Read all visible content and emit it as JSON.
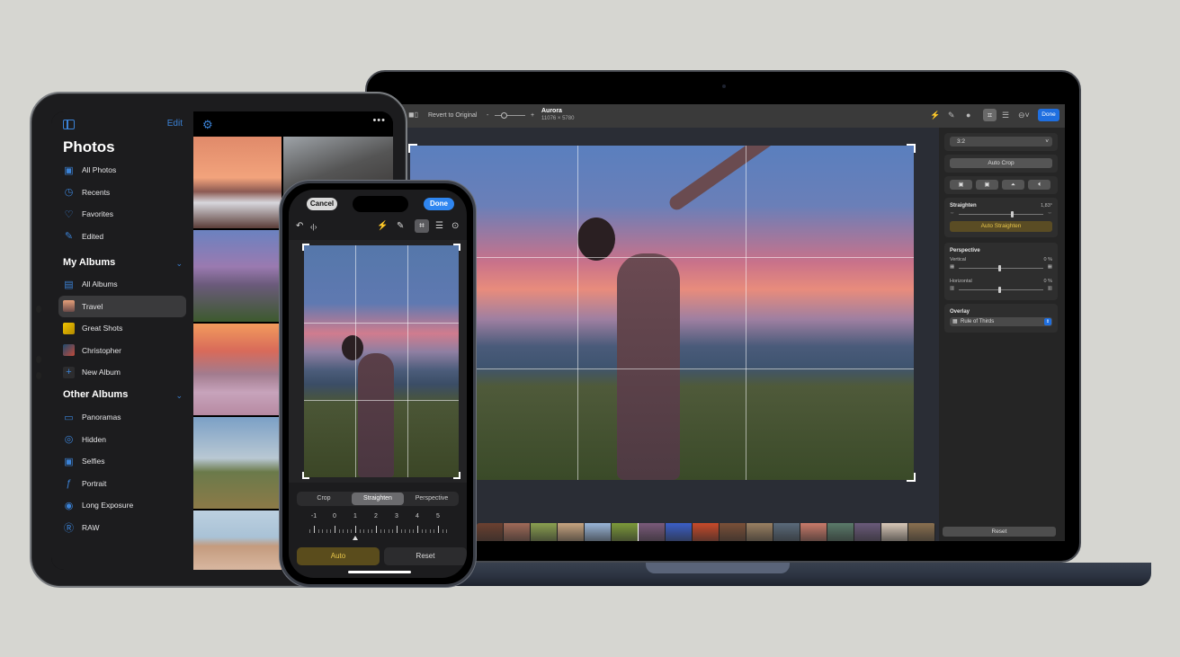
{
  "background_color": "#d6d6d1",
  "ipad": {
    "sidebar": {
      "edit_label": "Edit",
      "title": "Photos",
      "library_items": [
        {
          "label": "All Photos",
          "icon": "photo-library-icon"
        },
        {
          "label": "Recents",
          "icon": "clock-icon"
        },
        {
          "label": "Favorites",
          "icon": "heart-icon"
        },
        {
          "label": "Edited",
          "icon": "edit-square-icon"
        }
      ],
      "my_albums_heading": "My Albums",
      "my_albums": [
        {
          "label": "All Albums",
          "icon": "albums-stack-icon"
        },
        {
          "label": "Travel",
          "icon": "album-thumbnail",
          "selected": true
        },
        {
          "label": "Great Shots",
          "icon": "album-thumbnail"
        },
        {
          "label": "Christopher",
          "icon": "album-thumbnail"
        },
        {
          "label": "New Album",
          "icon": "plus-icon"
        }
      ],
      "other_albums_heading": "Other Albums",
      "other_albums": [
        {
          "label": "Panoramas",
          "icon": "panorama-icon"
        },
        {
          "label": "Hidden",
          "icon": "eye-slash-icon"
        },
        {
          "label": "Selfies",
          "icon": "person-square-icon"
        },
        {
          "label": "Portrait",
          "icon": "aperture-icon"
        },
        {
          "label": "Long Exposure",
          "icon": "long-exposure-icon"
        },
        {
          "label": "RAW",
          "icon": "raw-icon"
        }
      ]
    },
    "grid_toolbar": {
      "settings_icon": "gear-icon",
      "more_icon": "ellipsis-icon"
    }
  },
  "mac": {
    "toolbar": {
      "back_icon": "chevron-left-icon",
      "compare_icon": "compare-icon",
      "revert_label": "Revert to Original",
      "zoom_minus": "-",
      "zoom_plus": "+",
      "zoom_level": 0.25,
      "photo_title": "Aurora",
      "photo_dimensions": "11076 × 5780",
      "tools": [
        "auto-enhance-icon",
        "retouch-icon",
        "filters-icon",
        "crop-icon",
        "adjust-icon",
        "more-options-icon"
      ],
      "done_label": "Done"
    },
    "panel": {
      "aspect_ratio": "3:2",
      "auto_crop_label": "Auto Crop",
      "transform_icons": [
        "rotate-icon",
        "rotate-ccw-icon",
        "flip-vertical-icon",
        "flip-horizontal-icon"
      ],
      "straighten_label": "Straighten",
      "straighten_value": "1,83°",
      "straighten_position": 0.62,
      "auto_straighten_label": "Auto Straighten",
      "perspective_label": "Perspective",
      "vertical_label": "Vertical",
      "vertical_value": "0 %",
      "horizontal_label": "Horizontal",
      "horizontal_value": "0 %",
      "overlay_label": "Overlay",
      "overlay_value": "Rule of Thirds",
      "reset_label": "Reset"
    },
    "filmstrip_count": 17,
    "filmstrip_selected_index": 6
  },
  "iphone": {
    "cancel_label": "Cancel",
    "done_label": "Done",
    "toolbar_icons": [
      "undo-icon",
      "compare-icon",
      "auto-enhance-icon",
      "retouch-icon",
      "crop-icon",
      "adjust-icon",
      "more-icon"
    ],
    "segments": [
      {
        "label": "Crop"
      },
      {
        "label": "Straighten",
        "selected": true
      },
      {
        "label": "Perspective"
      }
    ],
    "ruler_labels": [
      "-1",
      "0",
      "1",
      "2",
      "3",
      "4",
      "5"
    ],
    "ruler_value": 1.83,
    "auto_label": "Auto",
    "reset_label": "Reset"
  }
}
